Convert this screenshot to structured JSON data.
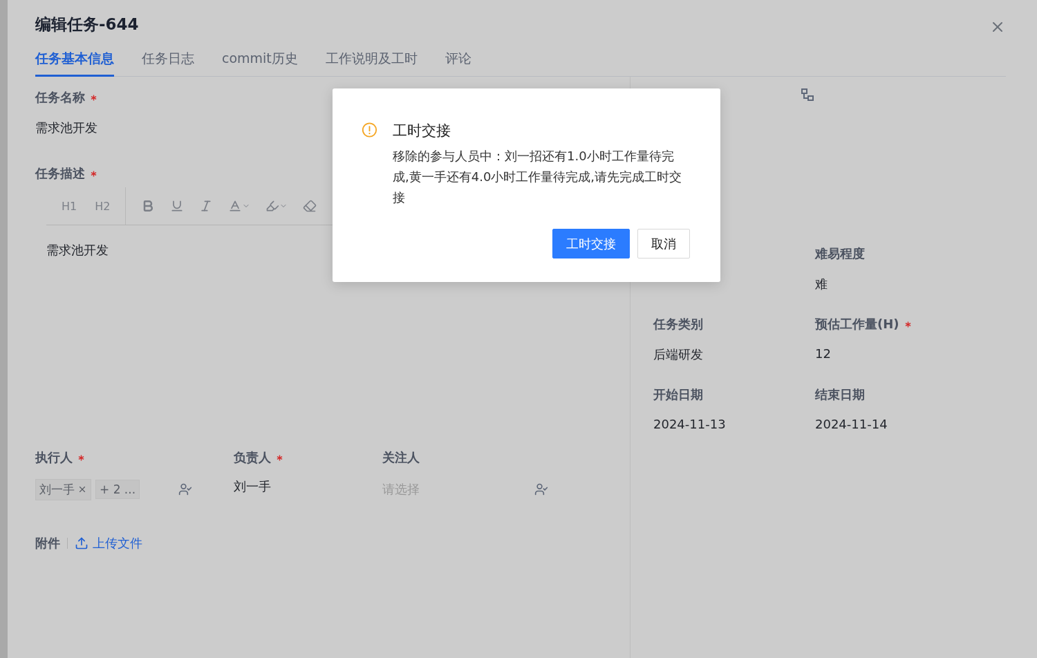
{
  "drawer": {
    "title": "编辑任务-644"
  },
  "tabs": [
    {
      "label": "任务基本信息",
      "selected": true
    },
    {
      "label": "任务日志",
      "selected": false
    },
    {
      "label": "commit历史",
      "selected": false
    },
    {
      "label": "工作说明及工时",
      "selected": false
    },
    {
      "label": "评论",
      "selected": false
    }
  ],
  "task_name": {
    "label": "任务名称",
    "required": true,
    "value": "需求池开发"
  },
  "task_description": {
    "label": "任务描述",
    "required": true,
    "heading_buttons": [
      "H1",
      "H2"
    ],
    "value": "需求池开发"
  },
  "people": [
    {
      "label": "执行人",
      "required": true,
      "kind": "tags",
      "tags": [
        {
          "label": "刘一手",
          "removable": true
        },
        {
          "label": "+ 2 ...",
          "removable": false
        }
      ]
    },
    {
      "label": "负责人",
      "required": true,
      "kind": "value",
      "value": "刘一手"
    },
    {
      "label": "关注人",
      "required": false,
      "kind": "picker",
      "placeholder": "请选择"
    }
  ],
  "attachments": {
    "label": "附件",
    "upload_link": "上传文件"
  },
  "details": [
    {
      "label": "难易程度",
      "required": false,
      "value": "难"
    },
    {
      "label": "任务类别",
      "required": false,
      "value": "后端研发"
    },
    {
      "label": "预估工作量(H)",
      "required": true,
      "value": "12"
    },
    {
      "label": "开始日期",
      "required": false,
      "value": "2024-11-13"
    },
    {
      "label": "结束日期",
      "required": false,
      "value": "2024-11-14"
    }
  ],
  "dialog": {
    "title": "工时交接",
    "message": "移除的参与人员中：刘一招还有1.0小时工作量待完成,黄一手还有4.0小时工作量待完成,请先完成工时交接",
    "buttons": [
      {
        "label": "工时交接",
        "kind": "primary"
      },
      {
        "label": "取消",
        "kind": "default"
      }
    ]
  }
}
